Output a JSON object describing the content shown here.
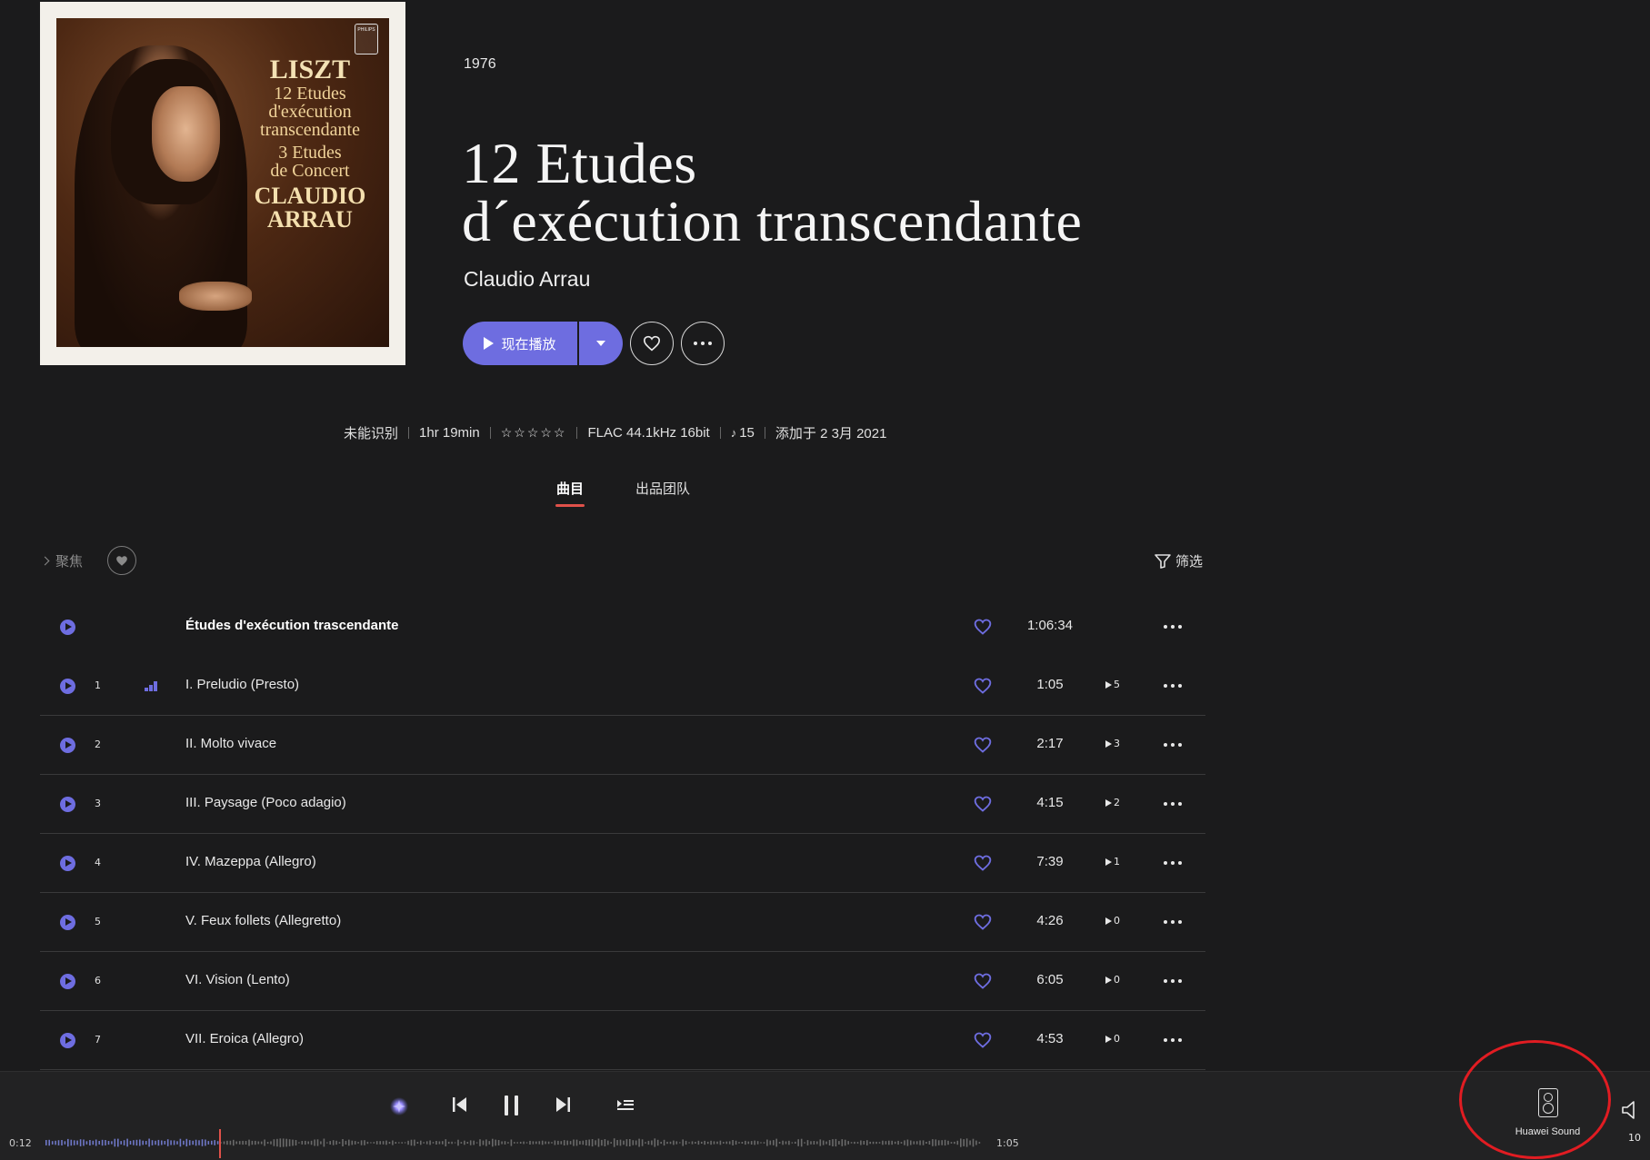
{
  "album": {
    "year": "1976",
    "title_line1": "12 Etudes",
    "title_line2": "d´exécution transcendante",
    "artist": "Claudio Arrau",
    "cover": {
      "logo": "PHILIPS",
      "line1": "LISZT",
      "line2": "12 Etudes",
      "line3": "d'exécution",
      "line4": "transcendante",
      "line5": "3 Etudes",
      "line6": "de Concert",
      "line7": "CLAUDIO",
      "line8": "ARRAU"
    }
  },
  "actions": {
    "play_now": "现在播放",
    "play_icon": "play-icon",
    "dropdown_icon": "chevron-down-icon",
    "favorite_icon": "heart-icon",
    "more_icon": "more-horizontal-icon"
  },
  "meta": {
    "genre": "未能识别",
    "duration": "1hr 19min",
    "rating": "☆☆☆☆☆",
    "format": "FLAC 44.1kHz 16bit",
    "tracks_prefix": "♪",
    "track_count": "15",
    "added": "添加于 2 3月 2021"
  },
  "tabs": [
    {
      "label": "曲目",
      "active": true
    },
    {
      "label": "出品团队",
      "active": false
    }
  ],
  "toolbar": {
    "focus": "聚焦",
    "filter": "筛选"
  },
  "tracks_header": {
    "name": "Études d'exécution trascendante",
    "duration": "1:06:34"
  },
  "tracks": [
    {
      "num": "1",
      "name": "I. Preludio (Presto)",
      "duration": "1:05",
      "plays": "5",
      "playing": true
    },
    {
      "num": "2",
      "name": "II. Molto vivace",
      "duration": "2:17",
      "plays": "3",
      "playing": false
    },
    {
      "num": "3",
      "name": "III. Paysage (Poco adagio)",
      "duration": "4:15",
      "plays": "2",
      "playing": false
    },
    {
      "num": "4",
      "name": "IV. Mazeppa (Allegro)",
      "duration": "7:39",
      "plays": "1",
      "playing": false
    },
    {
      "num": "5",
      "name": "V. Feux follets (Allegretto)",
      "duration": "4:26",
      "plays": "0",
      "playing": false
    },
    {
      "num": "6",
      "name": "VI. Vision (Lento)",
      "duration": "6:05",
      "plays": "0",
      "playing": false
    },
    {
      "num": "7",
      "name": "VII. Eroica (Allegro)",
      "duration": "4:53",
      "plays": "0",
      "playing": false
    }
  ],
  "player": {
    "elapsed": "0:12",
    "total": "1:05",
    "progress_fraction": 0.185,
    "device": "Huawei Sound",
    "volume": "10"
  },
  "colors": {
    "accent": "#6e6de0",
    "tab_underline": "#e0514a",
    "annotation": "#e11c22",
    "background": "#1b1b1c"
  }
}
